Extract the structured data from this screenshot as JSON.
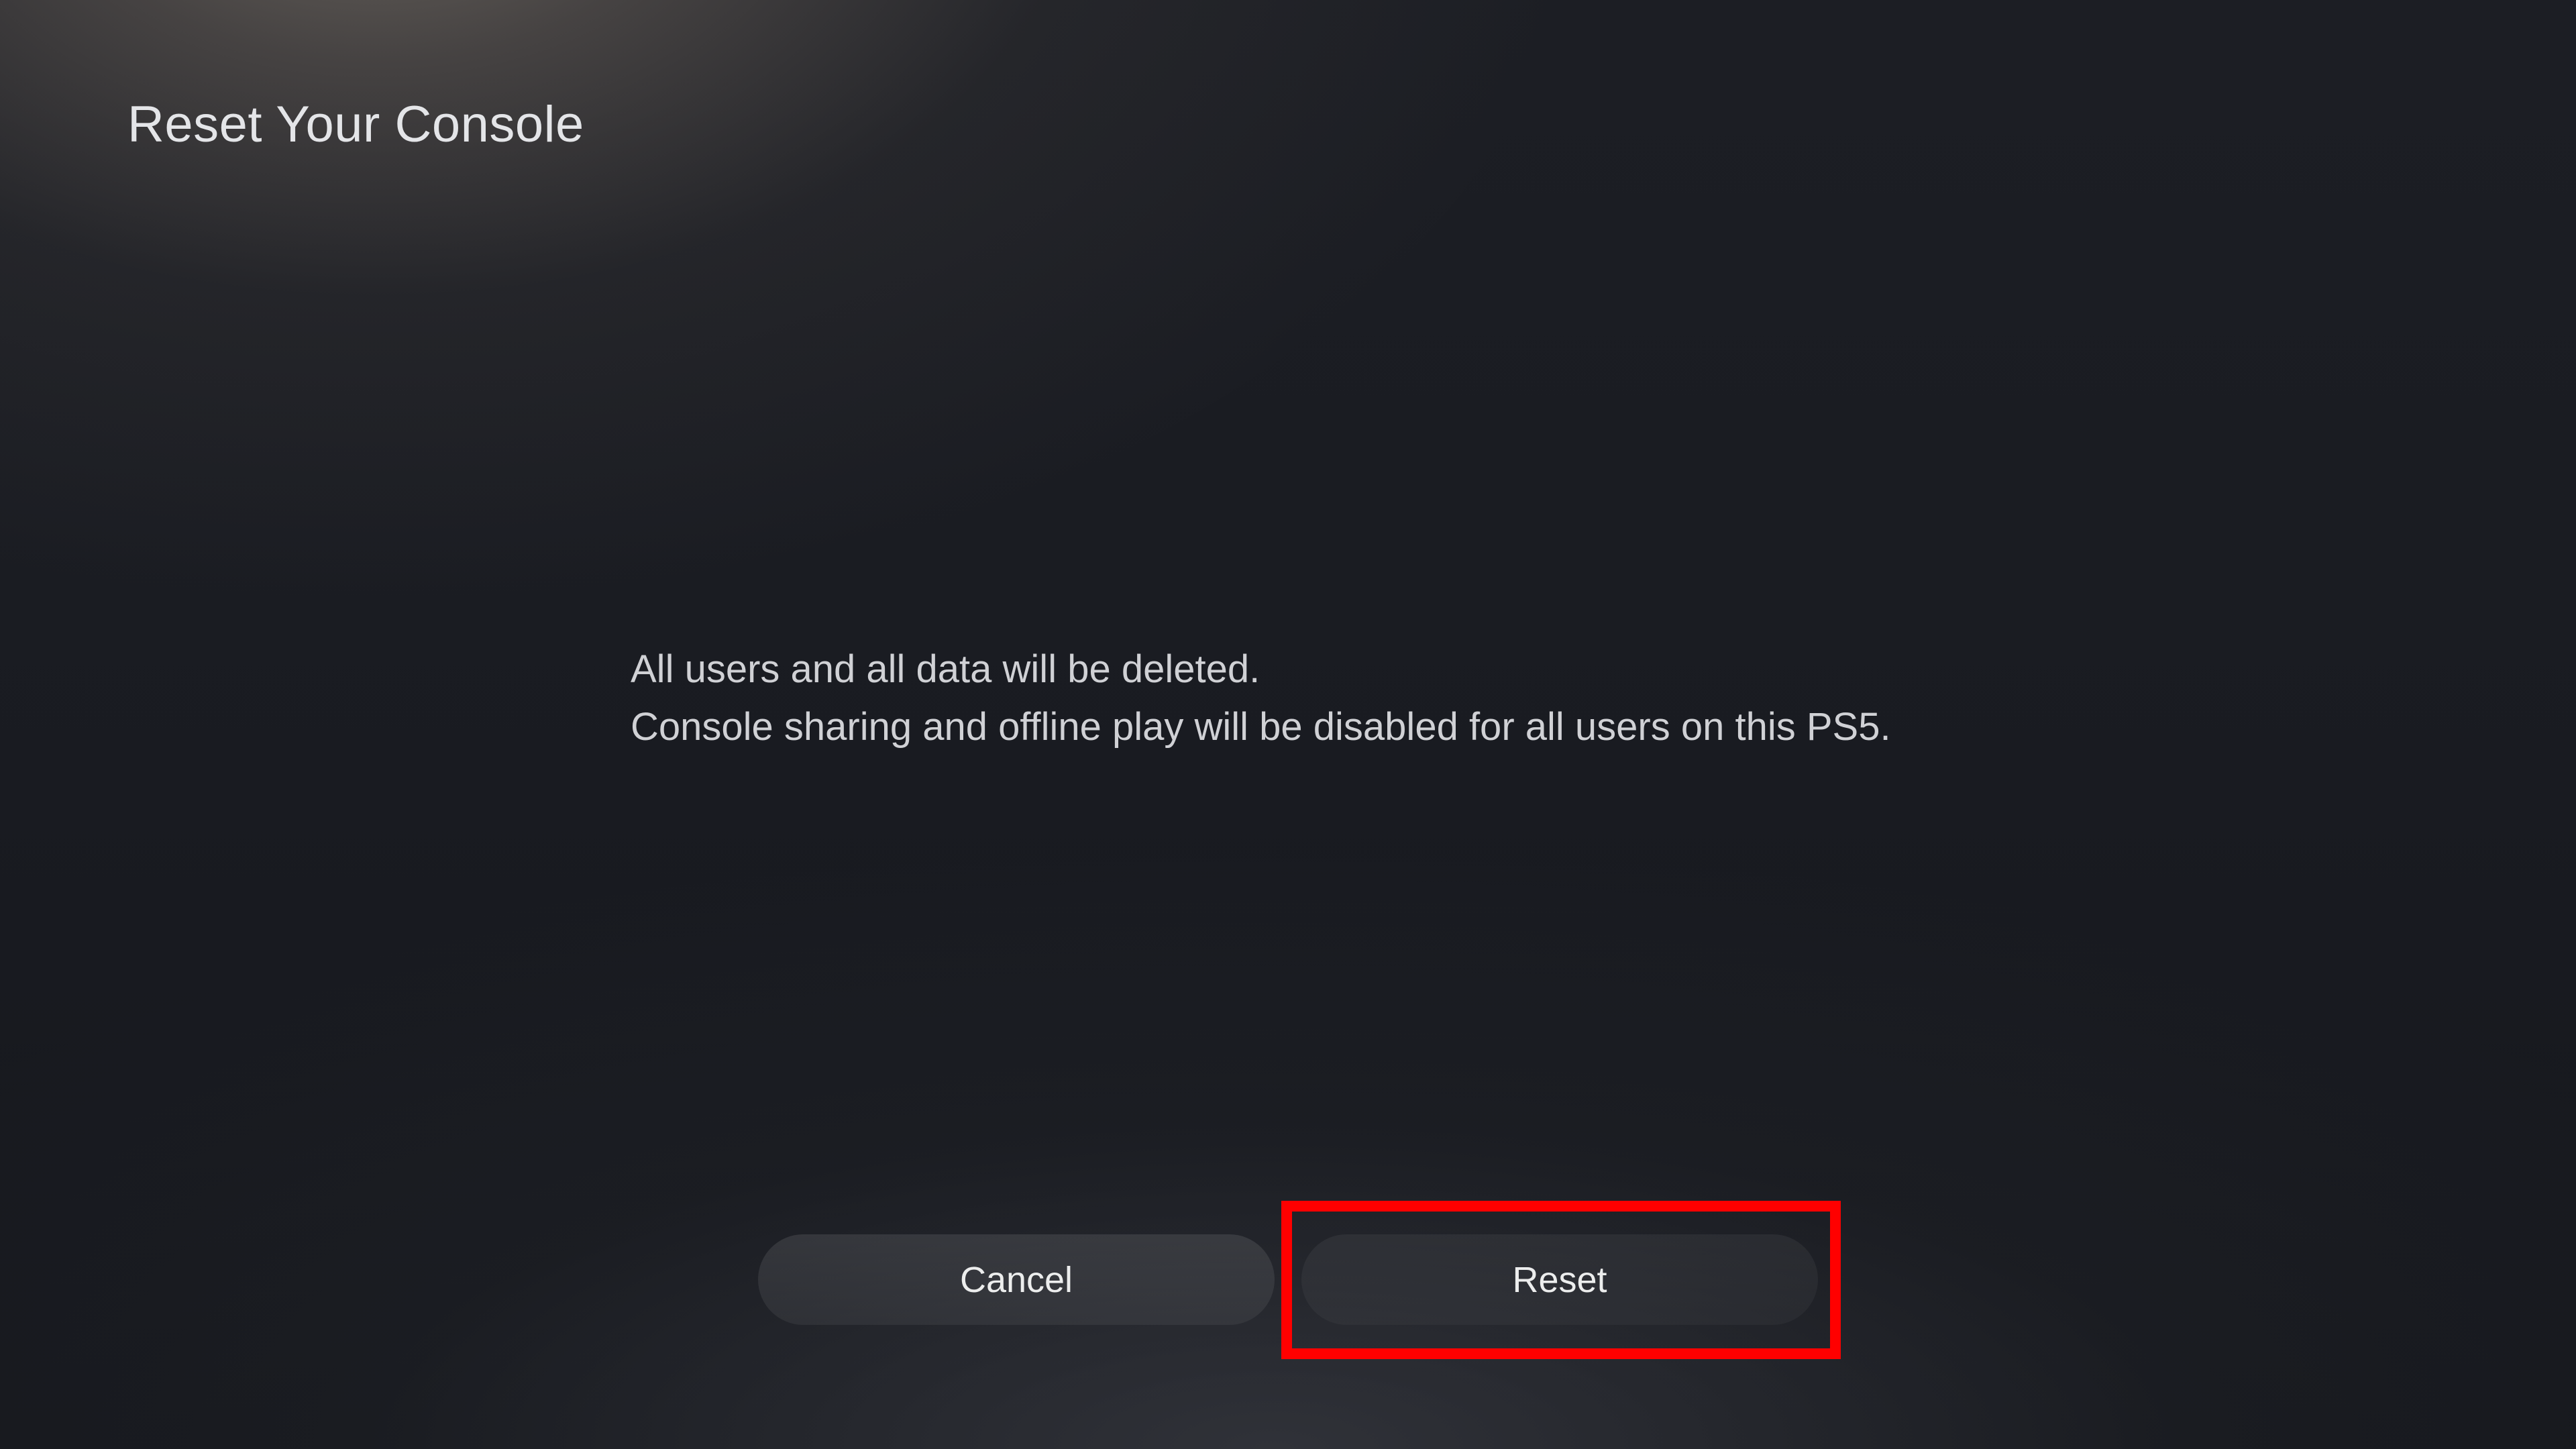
{
  "header": {
    "title": "Reset Your Console"
  },
  "message": {
    "line1": "All users and all data will be deleted.",
    "line2": "Console sharing and offline play will be disabled for all users on this PS5."
  },
  "buttons": {
    "cancel_label": "Cancel",
    "reset_label": "Reset"
  },
  "annotation": {
    "highlight_color": "#ff0000",
    "target": "reset-button"
  }
}
